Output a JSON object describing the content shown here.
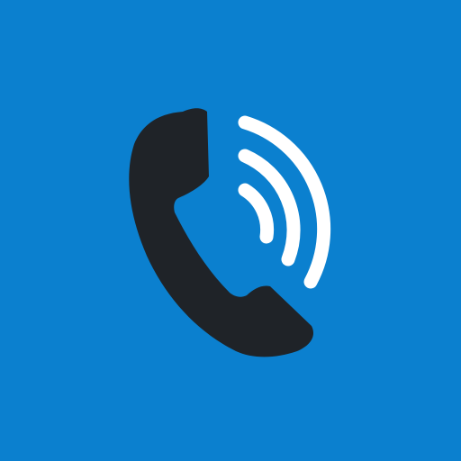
{
  "icon": {
    "name": "phone-call-icon",
    "colors": {
      "background": "#0b80cf",
      "handset": "#1f2328",
      "waves": "#ffffff"
    },
    "sound_wave_count": 3
  }
}
